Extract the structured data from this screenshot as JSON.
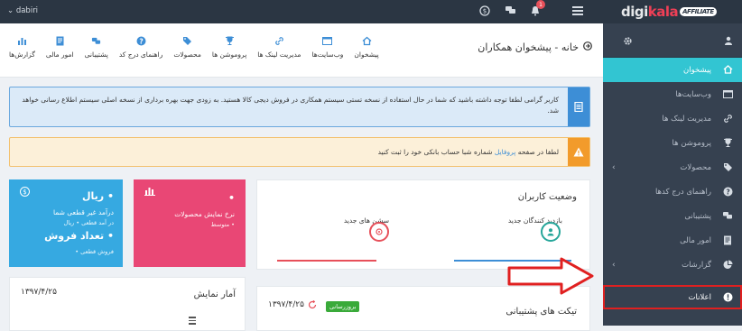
{
  "topbar": {
    "user_name": "dabiri",
    "notification_count": "1",
    "logo_text_prefix": "digi",
    "logo_text_brand": "kala",
    "logo_badge": "AFFILIATE"
  },
  "sidebar": {
    "items": [
      {
        "label": "پیشخوان",
        "icon": "home-icon",
        "active": true
      },
      {
        "label": "وب‌سایت‌ها",
        "icon": "browser-icon"
      },
      {
        "label": "مدیریت لینک ها",
        "icon": "link-icon"
      },
      {
        "label": "پروموشن ها",
        "icon": "trophy-icon"
      },
      {
        "label": "محصولات",
        "icon": "tag-icon",
        "has_children": true
      },
      {
        "label": "راهنمای درج کدها",
        "icon": "help-icon"
      },
      {
        "label": "پشتیبانی",
        "icon": "chat-icon"
      },
      {
        "label": "امور مالی",
        "icon": "doc-icon"
      },
      {
        "label": "گزارشات",
        "icon": "chart-icon",
        "has_children": true
      },
      {
        "label": "اعلانات",
        "icon": "alert-icon"
      }
    ]
  },
  "header": {
    "title": "خانه - پیشخوان همکاران",
    "nav": [
      {
        "label": "پیشخوان",
        "icon": "home-icon"
      },
      {
        "label": "وب‌سایت‌ها",
        "icon": "browser-icon"
      },
      {
        "label": "مدیریت لینک ها",
        "icon": "link-icon"
      },
      {
        "label": "پروموشن ها",
        "icon": "trophy-icon"
      },
      {
        "label": "محصولات",
        "icon": "tag-icon"
      },
      {
        "label": "راهنمای درج کد",
        "icon": "help-icon"
      },
      {
        "label": "پشتیبانی",
        "icon": "chat-icon"
      },
      {
        "label": "امور مالی",
        "icon": "doc-icon"
      },
      {
        "label": "گزارش‌ها",
        "icon": "chart-icon"
      }
    ]
  },
  "alerts": {
    "info_text": "کاربر گرامی لطفا توجه داشته باشید که شما در حال استفاده از نسخه تستی سیستم همکاری در فروش دیجی کالا هستید. به زودی جهت بهره برداری از نسخه اصلی سیستم اطلاع رسانی خواهد شد.",
    "warn_prefix": "لطفا در صفحه",
    "warn_link": "پروفایل",
    "warn_suffix": "شماره شبا حساب بانکی خود را ثبت کنید"
  },
  "user_status": {
    "title": "وضعیت کاربران",
    "new_visitors_label": "بازدید کنندگان جدید",
    "new_sessions_label": "سشن های جدید"
  },
  "tiles": {
    "blue": {
      "line1": "• ریال",
      "line2": "درآمد غیر قطعی شما",
      "line3": "در آمد قطعی • ریال",
      "line4": "• تعداد فروش",
      "line5": "فروش قطعی •"
    },
    "pink": {
      "line1": "•",
      "line2": "نرخ نمایش محصولات",
      "line3": "• متوسط"
    }
  },
  "stats_panel": {
    "title": "آمار نمایش",
    "date": "۱۳۹۷/۴/۲۵"
  },
  "tickets_panel": {
    "title": "تیکت های پشتیبانی",
    "badge": "بروزرسانی",
    "date": "۱۳۹۷/۴/۲۵"
  },
  "colors": {
    "sidebar_bg": "#364150",
    "active_item": "#32c5d2",
    "tile_blue": "#36a9e1",
    "tile_pink": "#e94775",
    "annotation_red": "#e02020"
  }
}
